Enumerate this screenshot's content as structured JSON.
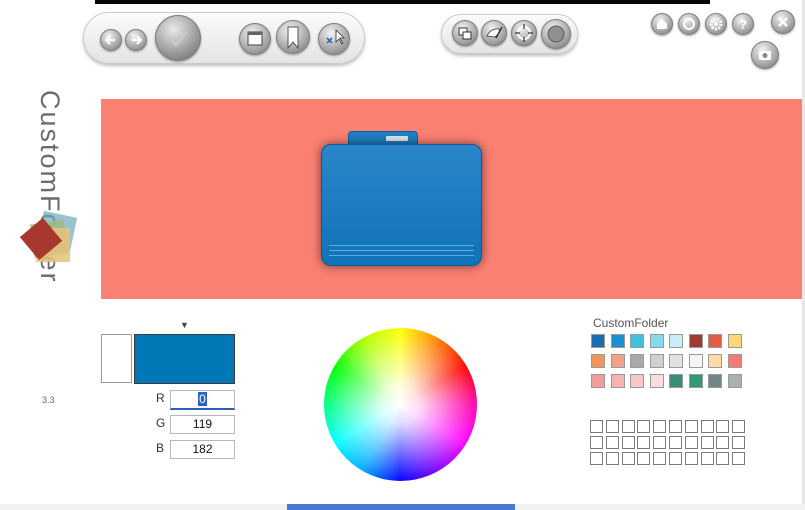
{
  "app": {
    "name": "CustomFolder",
    "version": "3.3"
  },
  "colors": {
    "banner_bg": "#fa8072",
    "folder_color": "#0077b6",
    "previous_color": "#ffffff"
  },
  "toolbar": {
    "left_group": [
      "back-arrow-icon",
      "forward-arrow-icon",
      "apply-icon"
    ],
    "mid_group": [
      "window-icon",
      "bookmark-icon",
      "cursor-icon"
    ],
    "right_group": [
      "layers-icon",
      "paint-icon",
      "refresh-arrows-icon",
      "circle-icon"
    ],
    "top_right": [
      "home-icon",
      "refresh-icon",
      "gear-icon",
      "help-icon",
      "close-icon"
    ],
    "screenshot": "camera-icon"
  },
  "rgb": {
    "r_label": "R",
    "g_label": "G",
    "b_label": "B",
    "r_value": "0",
    "g_value": "119",
    "b_value": "182"
  },
  "palette": {
    "title": "CustomFolder",
    "rows": [
      [
        "#1a6fb4",
        "#1b8fd2",
        "#3fc1e0",
        "#88d8ef",
        "#c7eef6",
        "#9e3b35",
        "#e35b44",
        "#ffd777"
      ],
      [
        "#f0955c",
        "#f4a08a",
        "#a9a9a9",
        "#d0d0d0",
        "#e1e1e1",
        "#f4f4f4",
        "#ffd9a6",
        "#f67b74"
      ],
      [
        "#f19c9a",
        "#f5b3b3",
        "#f8c8c8",
        "#fadddd",
        "#3d8c7a",
        "#2f9a76",
        "#6f8787",
        "#aab0b0"
      ]
    ],
    "custom_rows": 3,
    "custom_cols": 10
  }
}
